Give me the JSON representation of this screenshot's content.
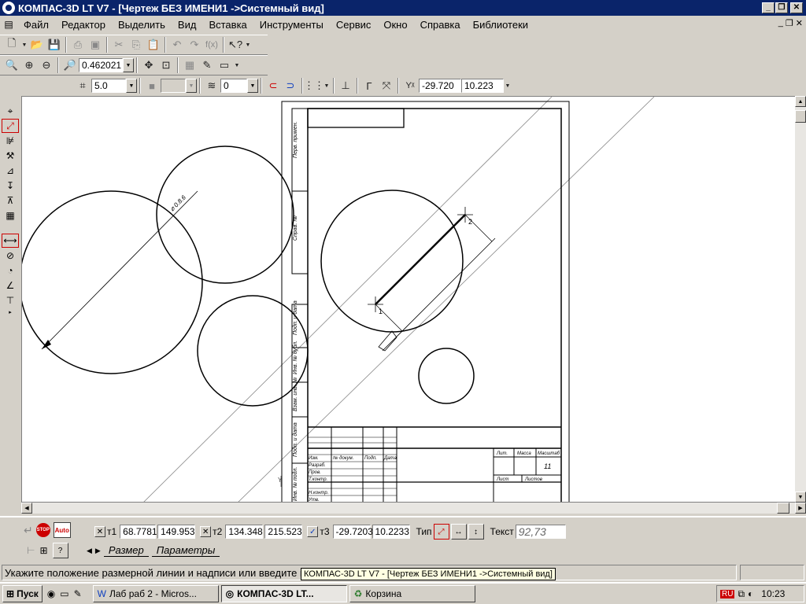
{
  "window": {
    "title": "КОМПАС-3D LT V7 - [Чертеж БЕЗ ИМЕНИ1 ->Системный вид]"
  },
  "menu": [
    "Файл",
    "Редактор",
    "Выделить",
    "Вид",
    "Вставка",
    "Инструменты",
    "Сервис",
    "Окно",
    "Справка",
    "Библиотеки"
  ],
  "view_toolbar": {
    "zoom": "0.462021"
  },
  "current_toolbar": {
    "step": "5.0",
    "layer": "0",
    "coord_label": "Y",
    "x": "-29.720",
    "y": "10.223"
  },
  "drawing": {
    "dim_main": "⌀ 0.8.6",
    "sheet_label": "11",
    "stamp_labels": [
      "Лит.",
      "Масса",
      "Масштаб",
      "Лист",
      "Листов"
    ],
    "side_labels": [
      "Перв. примен.",
      "Справ. №",
      "Подп. и дата",
      "Инв. № дубл.",
      "Взам. инв. №",
      "Подп. и дата",
      "Инв. № подл."
    ],
    "stamp_rows": [
      "Изм.",
      "Лист",
      "№ докум.",
      "Подп.",
      "Дата",
      "Разраб.",
      "Пров.",
      "Т.контр.",
      "Н.контр.",
      "Утв."
    ],
    "point1": "1",
    "point2": "2"
  },
  "property_panel": {
    "t1_label": "т1",
    "t1_x": "68.7781",
    "t1_y": "149.953",
    "t2_label": "т2",
    "t2_x": "134.348",
    "t2_y": "215.523",
    "t3_label": "т3",
    "t3_x": "-29.7203",
    "t3_y": "10.2233",
    "type_label": "Тип",
    "text_label": "Текст",
    "text_value": "92,73",
    "tab_size": "Размер",
    "tab_params": "Параметры",
    "auto_label": "Auto",
    "stop_label": "STOP"
  },
  "status": {
    "message": "Укажите положение размерной линии и надписи или введите к",
    "tooltip": "КОМПАС-3D LT V7 - [Чертеж БЕЗ ИМЕНИ1 ->Системный вид]"
  },
  "taskbar": {
    "start": "Пуск",
    "tasks": [
      "Лаб раб 2 - Micros...",
      "КОМПАС-3D LT...",
      "Корзина"
    ],
    "lang": "RU",
    "clock": "10:23"
  },
  "colors": {
    "title_bg": "#0a246a",
    "accent_red": "#cc0000"
  }
}
